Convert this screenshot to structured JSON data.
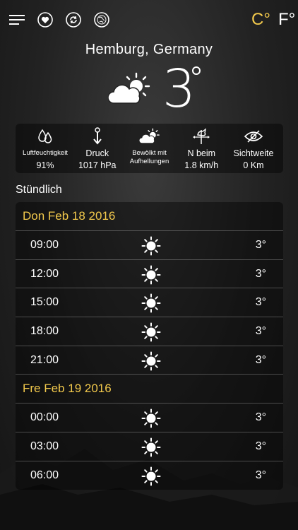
{
  "toolbar": {
    "menu_icon": "hamburger-menu-icon",
    "favorites_icon": "heart-icon",
    "refresh_icon": "refresh-icon",
    "globe_icon": "globe-icon",
    "unit_celsius": "C°",
    "unit_fahrenheit": "F°",
    "active_unit_color": "#f2c94c"
  },
  "location": "Hemburg, Germany",
  "current": {
    "temperature": "3",
    "icon": "partly-cloudy-icon"
  },
  "stats": [
    {
      "label": "Luftfeuchtigkeit",
      "value": "91%",
      "icon": "humidity-drops-icon"
    },
    {
      "label": "Druck",
      "value": "1017 hPa",
      "icon": "pressure-arrow-icon"
    },
    {
      "label": "Bewölkt mit Aufhellungen",
      "value": "",
      "icon": "partly-cloudy-icon"
    },
    {
      "label": "N beim",
      "value": "1.8 km/h",
      "icon": "weathervane-icon"
    },
    {
      "label": "Sichtweite",
      "value": "0 Km",
      "icon": "visibility-eye-icon"
    }
  ],
  "hourly_title": "Stündlich",
  "days": [
    {
      "date": "Don Feb 18 2016",
      "hours": [
        {
          "time": "09:00",
          "temp": "3°",
          "icon": "sun-icon"
        },
        {
          "time": "12:00",
          "temp": "3°",
          "icon": "sun-icon"
        },
        {
          "time": "15:00",
          "temp": "3°",
          "icon": "sun-icon"
        },
        {
          "time": "18:00",
          "temp": "3°",
          "icon": "sun-icon"
        },
        {
          "time": "21:00",
          "temp": "3°",
          "icon": "sun-icon"
        }
      ]
    },
    {
      "date": "Fre Feb 19 2016",
      "hours": [
        {
          "time": "00:00",
          "temp": "3°",
          "icon": "sun-icon"
        },
        {
          "time": "03:00",
          "temp": "3°",
          "icon": "sun-icon"
        },
        {
          "time": "06:00",
          "temp": "3°",
          "icon": "sun-icon"
        }
      ]
    }
  ]
}
